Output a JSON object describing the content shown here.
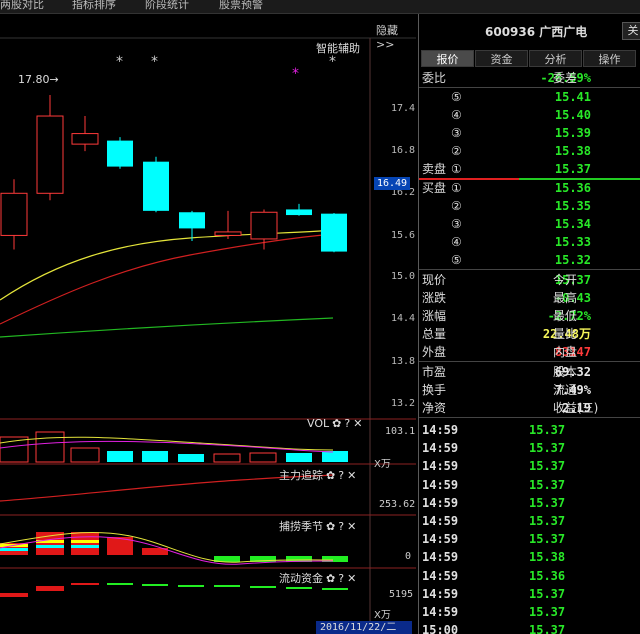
{
  "topbar": {
    "items": [
      "两股对比",
      "指标排序",
      "阶段统计",
      "股票预警"
    ]
  },
  "chart": {
    "hide_label": "隐藏>>",
    "smart_assist": "智能辅助",
    "high_label": "17.80→",
    "y_ticks": [
      "17.4",
      "16.8",
      "16.2",
      "15.6",
      "15.0",
      "14.4",
      "13.8",
      "13.2"
    ],
    "current_price": "16.49",
    "star_glyph": "*",
    "magenta_star_glyph": "*",
    "candles": [
      {
        "o": 15.6,
        "c": 16.2,
        "h": 16.4,
        "l": 15.4
      },
      {
        "o": 16.2,
        "c": 17.3,
        "h": 17.6,
        "l": 16.1
      },
      {
        "o": 16.9,
        "c": 17.05,
        "h": 17.3,
        "l": 16.8
      },
      {
        "o": 16.95,
        "c": 16.58,
        "h": 17.0,
        "l": 16.55
      },
      {
        "o": 16.65,
        "c": 15.95,
        "h": 16.72,
        "l": 15.93
      },
      {
        "o": 15.93,
        "c": 15.7,
        "h": 15.95,
        "l": 15.52
      },
      {
        "o": 15.6,
        "c": 15.65,
        "h": 15.95,
        "l": 15.55
      },
      {
        "o": 15.55,
        "c": 15.93,
        "h": 15.97,
        "l": 15.4
      },
      {
        "o": 15.97,
        "c": 15.89,
        "h": 16.05,
        "l": 15.88
      },
      {
        "o": 15.91,
        "c": 15.37,
        "h": 15.92,
        "l": 15.36
      }
    ]
  },
  "indicators": {
    "vol": {
      "title": "VOL",
      "value": "103.1",
      "unit": "X万"
    },
    "main_track": {
      "title": "主力追踪",
      "value": "253.62"
    },
    "catch_season": {
      "title": "捕捞季节",
      "value": "0"
    },
    "flow_fund": {
      "title": "流动资金",
      "value": "5195",
      "unit": "X万"
    },
    "icons": {
      "gear": "✿",
      "help": "?",
      "close": "✕"
    }
  },
  "date_label": "2016/11/22/二",
  "quote": {
    "stock_code": "600936 广西广电",
    "close_label": "关",
    "tabs": [
      "报价",
      "资金",
      "分析",
      "操作"
    ],
    "weibi_label": "委比",
    "weibi_value": "-26.59%",
    "weicha_label": "委差",
    "sell_label": "卖盘",
    "buy_label": "买盘",
    "sell_levels": [
      {
        "lvl": "⑤",
        "price": "15.41"
      },
      {
        "lvl": "④",
        "price": "15.40"
      },
      {
        "lvl": "③",
        "price": "15.39"
      },
      {
        "lvl": "②",
        "price": "15.38"
      },
      {
        "lvl": "①",
        "price": "15.37"
      }
    ],
    "buy_levels": [
      {
        "lvl": "①",
        "price": "15.36"
      },
      {
        "lvl": "②",
        "price": "15.35"
      },
      {
        "lvl": "③",
        "price": "15.34"
      },
      {
        "lvl": "④",
        "price": "15.33"
      },
      {
        "lvl": "⑤",
        "price": "15.32"
      }
    ],
    "stats": [
      {
        "label": "现价",
        "value": "15.37",
        "color": "green",
        "label2": "今开"
      },
      {
        "label": "涨跌",
        "value": "-0.43",
        "color": "green",
        "label2": "最高"
      },
      {
        "label": "涨幅",
        "value": "-2.72%",
        "color": "green",
        "label2": "最低"
      },
      {
        "label": "总量",
        "value": "22.48万",
        "color": "yellow",
        "label2": "量比"
      },
      {
        "label": "外盘",
        "value": "83147",
        "color": "red",
        "label2": "内盘"
      }
    ],
    "stats2": [
      {
        "label": "市盈",
        "value": "69.32",
        "label2": "股本"
      },
      {
        "label": "换手",
        "value": "7.49%",
        "label2": "流通"
      },
      {
        "label": "净资",
        "value": "2.19",
        "label2": "收益(三)"
      }
    ],
    "ticks": [
      {
        "time": "14:59",
        "price": "15.37"
      },
      {
        "time": "14:59",
        "price": "15.37"
      },
      {
        "time": "14:59",
        "price": "15.37"
      },
      {
        "time": "14:59",
        "price": "15.37"
      },
      {
        "time": "14:59",
        "price": "15.37"
      },
      {
        "time": "14:59",
        "price": "15.37"
      },
      {
        "time": "14:59",
        "price": "15.37"
      },
      {
        "time": "14:59",
        "price": "15.38"
      },
      {
        "time": "14:59",
        "price": "15.36"
      },
      {
        "time": "14:59",
        "price": "15.37"
      },
      {
        "time": "14:59",
        "price": "15.37"
      },
      {
        "time": "15:00",
        "price": "15.37"
      }
    ]
  }
}
